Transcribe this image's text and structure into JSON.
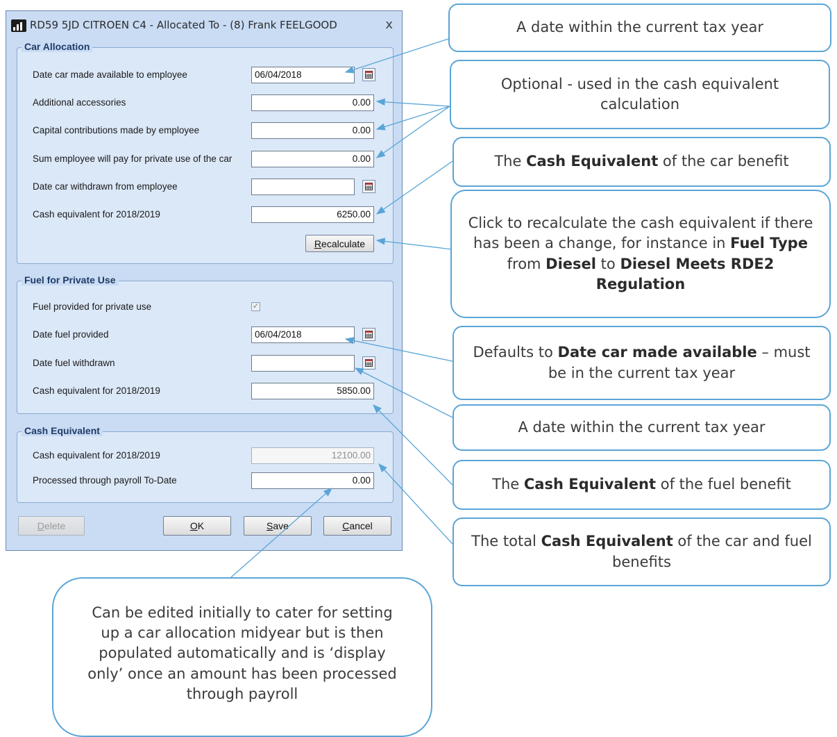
{
  "dialog": {
    "title": "RD59 5JD CITROEN C4 - Allocated To - (8) Frank FEELGOOD",
    "close_glyph": "x",
    "car_allocation": {
      "title": "Car Allocation",
      "date_available": {
        "label": "Date car made available to employee",
        "value": "06/04/2018"
      },
      "accessories": {
        "label": "Additional accessories",
        "value": "0.00"
      },
      "capital_contrib": {
        "label": "Capital contributions made by employee",
        "value": "0.00"
      },
      "private_use_sum": {
        "label": "Sum employee will pay for private use of the car",
        "value": "0.00"
      },
      "date_withdrawn": {
        "label": "Date car withdrawn from employee",
        "value": ""
      },
      "cash_equiv": {
        "label": "Cash equivalent for 2018/2019",
        "value": "6250.00"
      },
      "recalc_label": "Recalculate"
    },
    "fuel": {
      "title": "Fuel for Private Use",
      "provided": {
        "label": "Fuel provided for private use",
        "checked": "✓"
      },
      "date_provided": {
        "label": "Date fuel provided",
        "value": "06/04/2018"
      },
      "date_withdrawn": {
        "label": "Date fuel withdrawn",
        "value": ""
      },
      "cash_equiv": {
        "label": "Cash equivalent for 2018/2019",
        "value": "5850.00"
      }
    },
    "cash_equivalent": {
      "title": "Cash Equivalent",
      "total": {
        "label": "Cash equivalent for 2018/2019",
        "value": "12100.00"
      },
      "processed": {
        "label": "Processed through payroll To-Date",
        "value": "0.00"
      }
    },
    "buttons": {
      "delete": "Delete",
      "ok": "OK",
      "save": "Save",
      "cancel": "Cancel"
    }
  },
  "callouts": {
    "c1": "A date within the current tax year",
    "c2": "Optional - used in the cash equivalent calculation",
    "c3": {
      "pre": "The ",
      "bold": "Cash Equivalent",
      "post": " of the car benefit"
    },
    "c4": {
      "t1": "Click to recalculate the cash equivalent if there has been a change, for instance in ",
      "b1": "Fuel Type",
      "t2": " from ",
      "b2": "Diesel",
      "t3": " to ",
      "b3": "Diesel Meets RDE2 Regulation"
    },
    "c5": {
      "pre": "Defaults to ",
      "bold": "Date car made available",
      "post": " – must be in the current tax year"
    },
    "c6": "A date within the current tax year",
    "c7": {
      "pre": "The ",
      "bold": "Cash Equivalent",
      "post": " of the fuel benefit"
    },
    "c8": {
      "pre": "The total ",
      "bold": "Cash Equivalent",
      "post": " of the car and fuel benefits"
    },
    "c9": "Can be edited initially to cater for setting up a car allocation midyear but is then populated automatically and is ‘display only’ once an amount has been processed through payroll"
  },
  "colors": {
    "dialog_bg": "#c9dcf4",
    "group_border": "#8ba9cf",
    "callout_border": "#5aa5d6",
    "arrow": "#5aa5d6"
  },
  "icons": {
    "app": "app-bar-chart-icon",
    "calendar": "calendar-icon",
    "close": "close-icon"
  }
}
